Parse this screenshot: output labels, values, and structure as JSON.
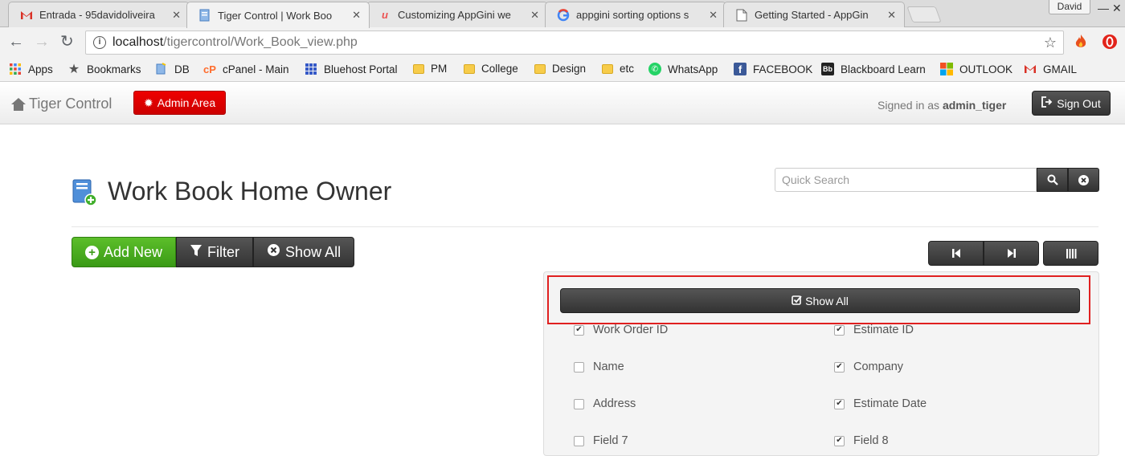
{
  "browser": {
    "tabs": [
      {
        "title": "Entrada - 95davidoliveira",
        "icon": "gmail-icon",
        "active": false
      },
      {
        "title": "Tiger Control | Work Boo",
        "icon": "appgini-page-icon",
        "active": true
      },
      {
        "title": "Customizing AppGini we",
        "icon": "udemy-icon",
        "active": false
      },
      {
        "title": "appgini sorting options s",
        "icon": "google-icon",
        "active": false
      },
      {
        "title": "Getting Started - AppGin",
        "icon": "document-icon",
        "active": false
      }
    ],
    "profile_name": "David",
    "url_host": "localhost",
    "url_path": "/tigercontrol/Work_Book_view.php",
    "bookmarks": [
      {
        "label": "Apps",
        "icon": "apps-grid-icon"
      },
      {
        "label": "Bookmarks",
        "icon": "star-icon"
      },
      {
        "label": "DB",
        "icon": "db-icon"
      },
      {
        "label": "cPanel - Main",
        "icon": "cpanel-icon"
      },
      {
        "label": "Bluehost Portal",
        "icon": "bluehost-icon"
      },
      {
        "label": "PM",
        "icon": "folder-icon"
      },
      {
        "label": "College",
        "icon": "folder-icon"
      },
      {
        "label": "Design",
        "icon": "folder-icon"
      },
      {
        "label": "etc",
        "icon": "folder-icon"
      },
      {
        "label": "WhatsApp",
        "icon": "whatsapp-icon"
      },
      {
        "label": "FACEBOOK",
        "icon": "facebook-icon"
      },
      {
        "label": "Blackboard Learn",
        "icon": "blackboard-icon"
      },
      {
        "label": "OUTLOOK",
        "icon": "outlook-icon"
      },
      {
        "label": "GMAIL",
        "icon": "gmail-icon"
      }
    ]
  },
  "navbar": {
    "brand": "Tiger Control",
    "admin_button": "Admin Area",
    "signed_in_prefix": "Signed in as",
    "username": "admin_tiger",
    "signout_button": "Sign Out"
  },
  "page": {
    "title": "Work Book Home Owner",
    "search_placeholder": "Quick Search",
    "buttons": {
      "add_new": "Add New",
      "filter": "Filter",
      "show_all": "Show All"
    },
    "column_panel": {
      "show_all_button": "Show All",
      "columns": [
        {
          "label": "Work Order ID",
          "checked": true
        },
        {
          "label": "Estimate ID",
          "checked": true
        },
        {
          "label": "Name",
          "checked": false
        },
        {
          "label": "Company",
          "checked": true
        },
        {
          "label": "Address",
          "checked": false
        },
        {
          "label": "Estimate Date",
          "checked": true
        },
        {
          "label": "Field 7",
          "checked": false
        },
        {
          "label": "Field 8",
          "checked": true
        }
      ]
    }
  },
  "colors": {
    "admin_red": "#dd0000",
    "add_green": "#4cae20",
    "dark_button": "#444444",
    "highlight_border": "#e02020"
  }
}
